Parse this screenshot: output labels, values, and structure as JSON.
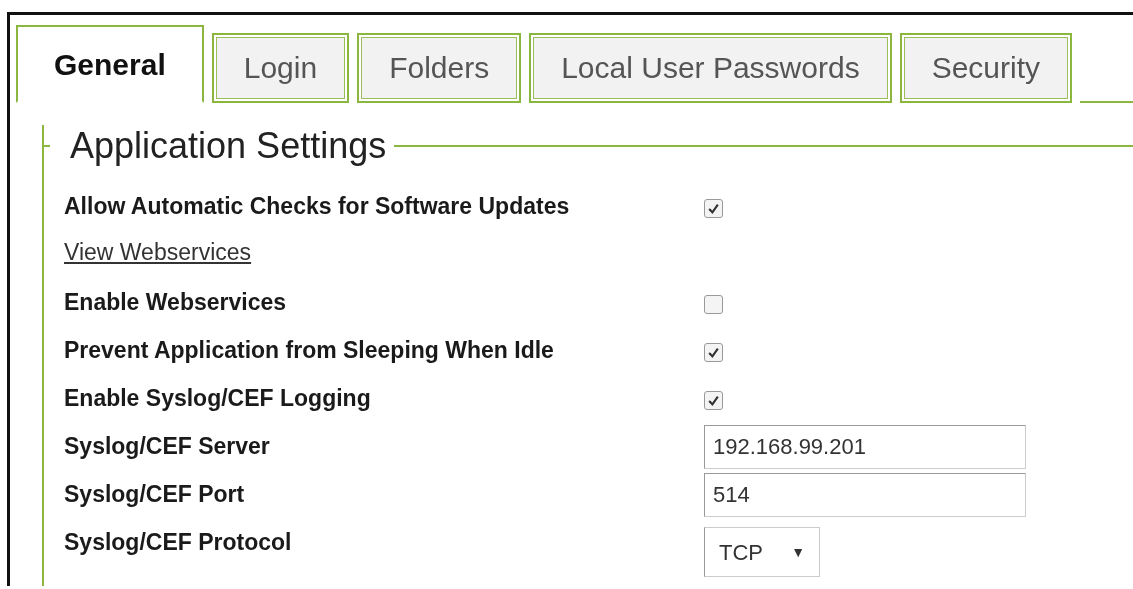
{
  "tabs": [
    {
      "label": "General",
      "selected": true
    },
    {
      "label": "Login",
      "selected": false
    },
    {
      "label": "Folders",
      "selected": false
    },
    {
      "label": "Local User Passwords",
      "selected": false
    },
    {
      "label": "Security",
      "selected": false
    }
  ],
  "section": {
    "title": "Application Settings"
  },
  "rows": [
    {
      "kind": "checkbox",
      "label": "Allow Automatic Checks for Software Updates",
      "checked": true
    },
    {
      "kind": "link",
      "label": "View Webservices"
    },
    {
      "kind": "checkbox",
      "label": "Enable Webservices",
      "checked": false
    },
    {
      "kind": "checkbox",
      "label": "Prevent Application from Sleeping When Idle",
      "checked": true
    },
    {
      "kind": "checkbox",
      "label": "Enable Syslog/CEF Logging",
      "checked": true
    },
    {
      "kind": "text",
      "label": "Syslog/CEF Server",
      "value": "192.168.99.201"
    },
    {
      "kind": "text",
      "label": "Syslog/CEF Port",
      "value": "514"
    },
    {
      "kind": "select",
      "label": "Syslog/CEF Protocol",
      "value": "TCP",
      "arrow": "▼"
    }
  ]
}
